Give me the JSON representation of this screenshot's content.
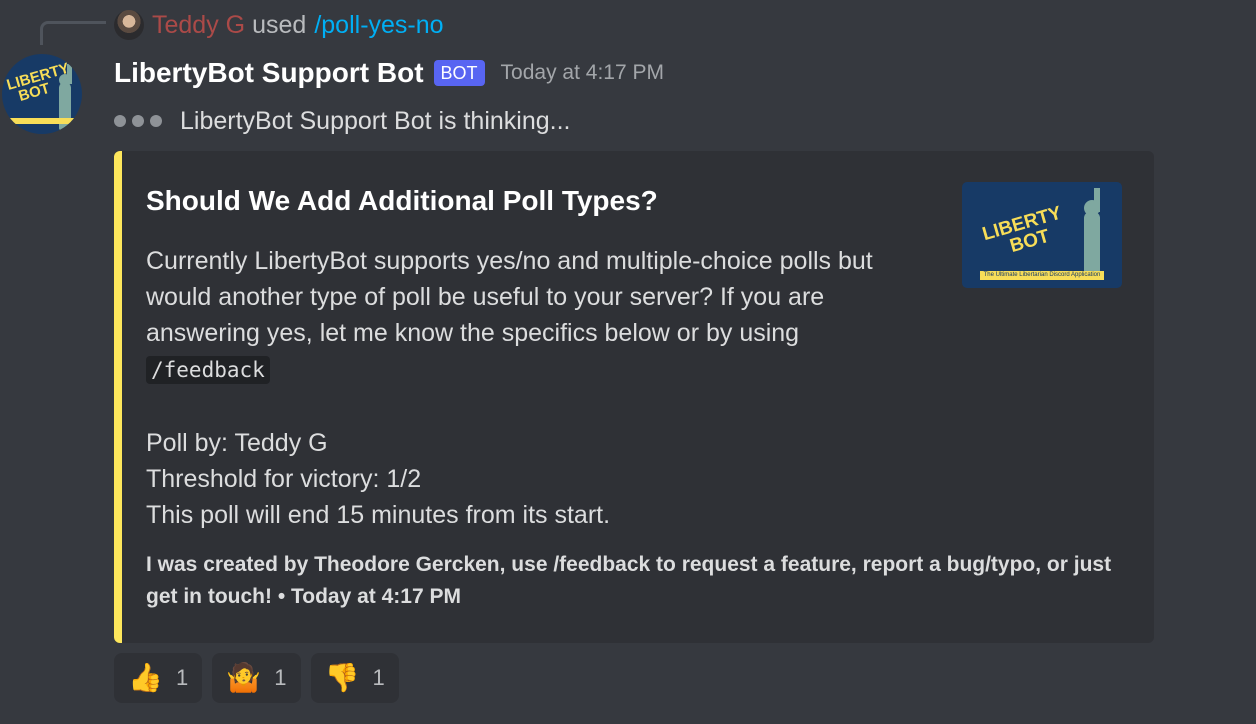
{
  "reply": {
    "username": "Teddy G",
    "used_text": "used",
    "command": "/poll-yes-no"
  },
  "message": {
    "username": "LibertyBot Support Bot",
    "bot_tag": "BOT",
    "timestamp": "Today at 4:17 PM",
    "thinking": "LibertyBot Support Bot is thinking..."
  },
  "avatar": {
    "text": "LIBERTY\n  BOT"
  },
  "embed": {
    "accent_color": "#fee75c",
    "title": "Should We Add Additional Poll Types?",
    "description": "Currently LibertyBot supports yes/no and multiple-choice polls but would another type of poll be useful to your server? If you are answering yes, let me know the specifics below or by using",
    "code": "/feedback",
    "poll_by": "Poll by: Teddy G",
    "threshold": "Threshold for victory: 1/2",
    "end": "This poll will end 15 minutes from its start.",
    "footer": "I was created by Theodore Gercken, use /feedback to request a feature, report a bug/typo, or just get in touch! • Today at 4:17 PM",
    "thumbnail_text": "LIBERTY\n BOT",
    "thumbnail_caption": "The Ultimate Libertarian Discord Application"
  },
  "reactions": [
    {
      "emoji": "👍",
      "icon": "thumbs-up-icon",
      "count": "1"
    },
    {
      "emoji": "🤷",
      "icon": "shrug-icon",
      "count": "1"
    },
    {
      "emoji": "👎",
      "icon": "thumbs-down-icon",
      "count": "1"
    }
  ]
}
